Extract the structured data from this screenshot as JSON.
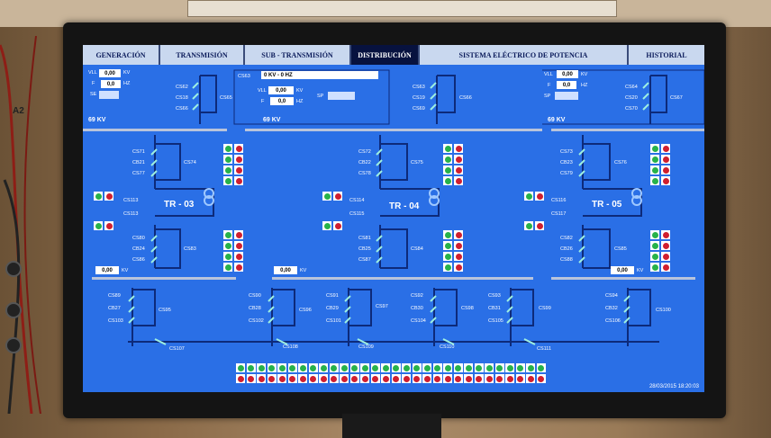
{
  "tabs": [
    {
      "label": "GENERACIÓN",
      "active": false
    },
    {
      "label": "TRANSMISIÓN",
      "active": false
    },
    {
      "label": "SUB - TRANSMISIÓN",
      "active": false
    },
    {
      "label": "DISTRIBUCIÓN",
      "active": true
    },
    {
      "label": "SISTEMA ELÉCTRICO DE POTENCIA",
      "active": false
    },
    {
      "label": "HISTORIAL",
      "active": false
    }
  ],
  "top_left": {
    "v_label": "VLL",
    "v_value": "0,00",
    "v_unit": "KV",
    "f_label": "F",
    "f_value": "0,0",
    "f_unit": "HZ",
    "s_label": "SE",
    "bus_label": "69 KV",
    "breakers": [
      "CS62",
      "CS18",
      "CS66"
    ],
    "main_breaker": "CS65"
  },
  "top_center": {
    "header": "0 KV - 0 HZ",
    "v_label": "VLL",
    "v_value": "0,00",
    "v_unit": "KV",
    "f_label": "F",
    "f_value": "0,0",
    "f_unit": "HZ",
    "sp_label": "SP",
    "bus_label": "69 KV",
    "breakers": [
      "CS63",
      "CS19",
      "CS69"
    ],
    "main_breaker": "CS66"
  },
  "top_right": {
    "v_label": "VLL",
    "v_value": "0,00",
    "v_unit": "KV",
    "f_label": "F",
    "f_value": "0,0",
    "f_unit": "HZ",
    "sp_label": "SP",
    "bus_label": "69 KV",
    "breakers": [
      "CS64",
      "CS20",
      "CS70"
    ],
    "main_breaker": "CS67"
  },
  "transformers": [
    {
      "name": "TR - 03",
      "upper": [
        "CS71",
        "CB21",
        "CS77"
      ],
      "upper_main": "CS74",
      "lower": [
        "CS80",
        "CB24",
        "CS86"
      ],
      "lower_main": "CS83",
      "tap_top": "CS113",
      "tap_bottom": "CS113",
      "bus_value": "0,00",
      "bus_unit": "KV"
    },
    {
      "name": "TR - 04",
      "upper": [
        "CS72",
        "CB22",
        "CS78"
      ],
      "upper_main": "CS75",
      "lower": [
        "CS81",
        "CB25",
        "CS87"
      ],
      "lower_main": "CS84",
      "tap_top": "CS114",
      "tap_bottom": "CS115",
      "bus_value": "0,00",
      "bus_unit": "KV"
    },
    {
      "name": "TR - 05",
      "upper": [
        "CS73",
        "CB23",
        "CS79"
      ],
      "upper_main": "CS76",
      "lower": [
        "CS82",
        "CB26",
        "CS88"
      ],
      "lower_main": "CS85",
      "tap_top": "CS116",
      "tap_bottom": "CS117",
      "bus_value": "0,00",
      "bus_unit": "KV"
    }
  ],
  "feeders": [
    {
      "b": [
        "CS89",
        "CB27",
        "CS103"
      ],
      "main": "CS95"
    },
    {
      "b": [
        "CS90",
        "CB28",
        "CS102"
      ],
      "main": "CS96"
    },
    {
      "b": [
        "CS91",
        "CB29",
        "CS101"
      ],
      "main": "CS97"
    },
    {
      "b": [
        "CS92",
        "CB30",
        "CS104"
      ],
      "main": "CS98"
    },
    {
      "b": [
        "CS93",
        "CB31",
        "CS105"
      ],
      "main": "CS99"
    },
    {
      "b": [
        "CS94",
        "CB32",
        "CS106"
      ],
      "main": "CS100"
    }
  ],
  "bottom_bus_labels": [
    "CS107",
    "CS108",
    "CS109",
    "CS110",
    "CS111"
  ],
  "colors": {
    "screen": "#2a6fe6",
    "active_tab": "#07123f",
    "led_green": "#27b24a",
    "led_red": "#d01f2f"
  },
  "datetime": "28/03/2015 18:20:03",
  "side_label": "A2"
}
